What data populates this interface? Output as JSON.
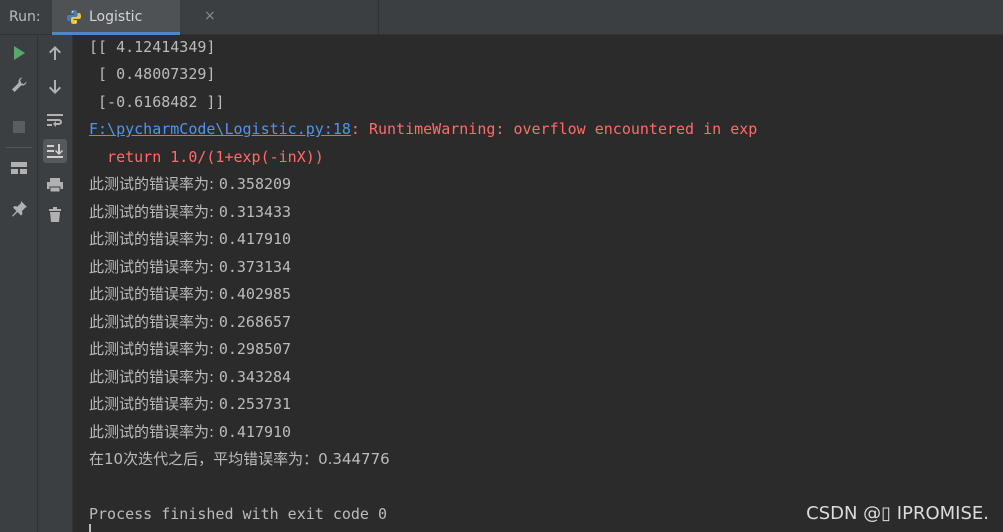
{
  "header": {
    "run_label": "Run:",
    "tab_label": "Logistic",
    "tab_close": "×"
  },
  "toolbar_left": [
    {
      "name": "run-icon"
    },
    {
      "name": "wrench-icon"
    },
    {
      "name": "stop-icon"
    },
    {
      "name": "layout-icon"
    },
    {
      "name": "pin-icon"
    }
  ],
  "toolbar_second": [
    {
      "name": "up-arrow-icon"
    },
    {
      "name": "down-arrow-icon"
    },
    {
      "name": "soft-wrap-icon"
    },
    {
      "name": "scroll-to-end-icon"
    },
    {
      "name": "print-icon"
    },
    {
      "name": "trash-icon"
    }
  ],
  "console": {
    "matrix": [
      "[[ 4.12414349]",
      " [ 0.48007329]",
      " [-0.6168482 ]]"
    ],
    "warning_link": "F:\\pycharmCode\\Logistic.py:18",
    "warning_msg": ": RuntimeWarning: overflow encountered in exp",
    "warning_code": "  return 1.0/(1+exp(-inX))",
    "error_prefix": "此测试的错误率为: ",
    "error_rates": [
      "0.358209",
      "0.313433",
      "0.417910",
      "0.373134",
      "0.402985",
      "0.268657",
      "0.298507",
      "0.343284",
      "0.253731",
      "0.417910"
    ],
    "average_line": "在10次迭代之后，平均错误率为：0.344776",
    "finish_line": "Process finished with exit code 0"
  },
  "watermark": "CSDN @▯ IPROMISE.",
  "colors": {
    "background": "#2b2b2b",
    "panel": "#3c3f41",
    "warning": "#ff6b68",
    "link": "#5394ec",
    "run_green": "#59a869"
  }
}
